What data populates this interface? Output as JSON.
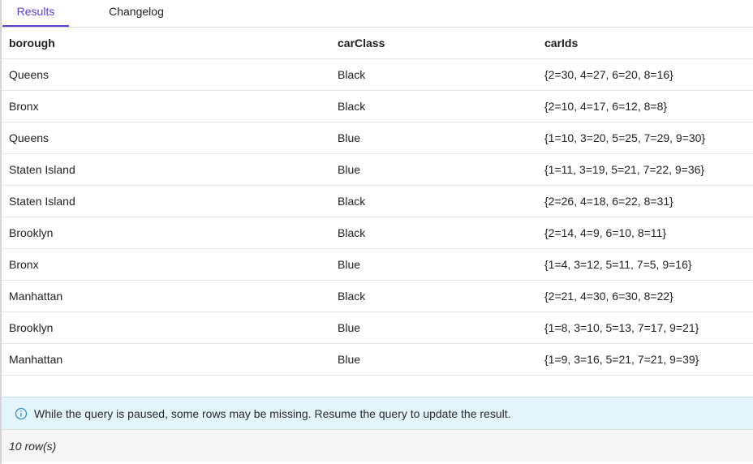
{
  "tabs": {
    "results": "Results",
    "changelog": "Changelog"
  },
  "table": {
    "headers": [
      "borough",
      "carClass",
      "carIds"
    ],
    "rows": [
      [
        "Queens",
        "Black",
        "{2=30, 4=27, 6=20, 8=16}"
      ],
      [
        "Bronx",
        "Black",
        "{2=10, 4=17, 6=12, 8=8}"
      ],
      [
        "Queens",
        "Blue",
        "{1=10, 3=20, 5=25, 7=29, 9=30}"
      ],
      [
        "Staten Island",
        "Blue",
        "{1=11, 3=19, 5=21, 7=22, 9=36}"
      ],
      [
        "Staten Island",
        "Black",
        "{2=26, 4=18, 6=22, 8=31}"
      ],
      [
        "Brooklyn",
        "Black",
        "{2=14, 4=9, 6=10, 8=11}"
      ],
      [
        "Bronx",
        "Blue",
        "{1=4, 3=12, 5=11, 7=5, 9=16}"
      ],
      [
        "Manhattan",
        "Black",
        "{2=21, 4=30, 6=30, 8=22}"
      ],
      [
        "Brooklyn",
        "Blue",
        "{1=8, 3=10, 5=13, 7=17, 9=21}"
      ],
      [
        "Manhattan",
        "Blue",
        "{1=9, 3=16, 5=21, 7=21, 9=39}"
      ]
    ]
  },
  "banner": {
    "text": "While the query is paused, some rows may be missing. Resume the query to update the result.",
    "icon": "info-icon"
  },
  "footer": {
    "row_count": "10 row(s)"
  },
  "colors": {
    "accent": "#5b3fd6",
    "banner_bg": "#e3f4fb",
    "info_icon": "#2f8fd0"
  }
}
